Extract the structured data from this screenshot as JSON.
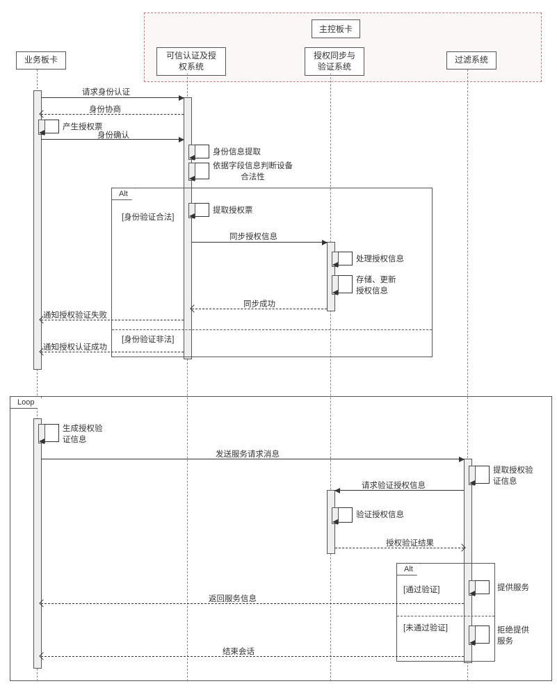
{
  "outerBoxTitle": "主控板卡",
  "lifelines": {
    "biz": {
      "label": "业务板卡"
    },
    "auth": {
      "label": "可信认证及授\n权系统"
    },
    "sync": {
      "label": "授权同步与\n验证系统"
    },
    "filter": {
      "label": "过滤系统"
    }
  },
  "messages": {
    "m1": "请求身份认证",
    "m2": "身份协商",
    "s1": "产生授权票",
    "m3": "身份确认",
    "s2": "身份信息提取",
    "s3": "依据字段信息判断设备\n合法性",
    "s4": "提取授权票",
    "m4": "同步授权信息",
    "s5": "处理授权信息",
    "s6": "存储、更新\n授权信息",
    "m5": "同步成功",
    "m6": "通知授权验证失败",
    "m7": "通知授权认证成功",
    "s7": "生成授权验\n证信息",
    "m8": "发送服务请求消息",
    "s8": "提取授权验\n证信息",
    "m9": "请求验证授权信息",
    "s9": "验证授权信息",
    "m10": "授权验证结果",
    "s10": "提供服务",
    "m11": "返回服务信息",
    "s11": "拒绝提供\n服务",
    "m12": "结束会话"
  },
  "fragments": {
    "alt1": {
      "tag": "Alt",
      "guard1": "[身份验证合法]",
      "guard2": "[身份验证非法]"
    },
    "loop": {
      "tag": "Loop"
    },
    "alt2": {
      "tag": "Alt",
      "guard1": "[通过验证]",
      "guard2": "[未通过验证]"
    }
  },
  "chart_data": {
    "type": "sequence-diagram",
    "participants": [
      "业务板卡",
      "主控板卡.可信认证及授权系统",
      "主控板卡.授权同步与验证系统",
      "主控板卡.过滤系统"
    ],
    "interactions": [
      {
        "from": "业务板卡",
        "to": "可信认证及授权系统",
        "label": "请求身份认证",
        "kind": "sync"
      },
      {
        "from": "可信认证及授权系统",
        "to": "业务板卡",
        "label": "身份协商",
        "kind": "return"
      },
      {
        "from": "业务板卡",
        "to": "业务板卡",
        "label": "产生授权票",
        "kind": "self"
      },
      {
        "from": "业务板卡",
        "to": "可信认证及授权系统",
        "label": "身份确认",
        "kind": "sync"
      },
      {
        "from": "可信认证及授权系统",
        "to": "可信认证及授权系统",
        "label": "身份信息提取",
        "kind": "self"
      },
      {
        "from": "可信认证及授权系统",
        "to": "可信认证及授权系统",
        "label": "依据字段信息判断设备合法性",
        "kind": "self"
      },
      {
        "fragment": "Alt",
        "guard": "[身份验证合法]",
        "children": [
          {
            "from": "可信认证及授权系统",
            "to": "可信认证及授权系统",
            "label": "提取授权票",
            "kind": "self"
          },
          {
            "from": "可信认证及授权系统",
            "to": "授权同步与验证系统",
            "label": "同步授权信息",
            "kind": "sync"
          },
          {
            "from": "授权同步与验证系统",
            "to": "授权同步与验证系统",
            "label": "处理授权信息",
            "kind": "self"
          },
          {
            "from": "授权同步与验证系统",
            "to": "授权同步与验证系统",
            "label": "存储、更新授权信息",
            "kind": "self"
          },
          {
            "from": "授权同步与验证系统",
            "to": "可信认证及授权系统",
            "label": "同步成功",
            "kind": "return"
          },
          {
            "from": "可信认证及授权系统",
            "to": "业务板卡",
            "label": "通知授权验证失败",
            "kind": "return"
          }
        ],
        "else": {
          "guard": "[身份验证非法]",
          "children": [
            {
              "from": "可信认证及授权系统",
              "to": "业务板卡",
              "label": "通知授权认证成功",
              "kind": "return"
            }
          ]
        }
      },
      {
        "fragment": "Loop",
        "children": [
          {
            "from": "业务板卡",
            "to": "业务板卡",
            "label": "生成授权验证信息",
            "kind": "self"
          },
          {
            "from": "业务板卡",
            "to": "过滤系统",
            "label": "发送服务请求消息",
            "kind": "sync"
          },
          {
            "from": "过滤系统",
            "to": "过滤系统",
            "label": "提取授权验证信息",
            "kind": "self"
          },
          {
            "from": "过滤系统",
            "to": "授权同步与验证系统",
            "label": "请求验证授权信息",
            "kind": "sync"
          },
          {
            "from": "授权同步与验证系统",
            "to": "授权同步与验证系统",
            "label": "验证授权信息",
            "kind": "self"
          },
          {
            "from": "授权同步与验证系统",
            "to": "过滤系统",
            "label": "授权验证结果",
            "kind": "return"
          },
          {
            "fragment": "Alt",
            "guard": "[通过验证]",
            "children": [
              {
                "from": "过滤系统",
                "to": "过滤系统",
                "label": "提供服务",
                "kind": "self"
              },
              {
                "from": "过滤系统",
                "to": "业务板卡",
                "label": "返回服务信息",
                "kind": "return"
              }
            ],
            "else": {
              "guard": "[未通过验证]",
              "children": [
                {
                  "from": "过滤系统",
                  "to": "过滤系统",
                  "label": "拒绝提供服务",
                  "kind": "self"
                },
                {
                  "from": "过滤系统",
                  "to": "业务板卡",
                  "label": "结束会话",
                  "kind": "return"
                }
              ]
            }
          }
        ]
      }
    ]
  }
}
